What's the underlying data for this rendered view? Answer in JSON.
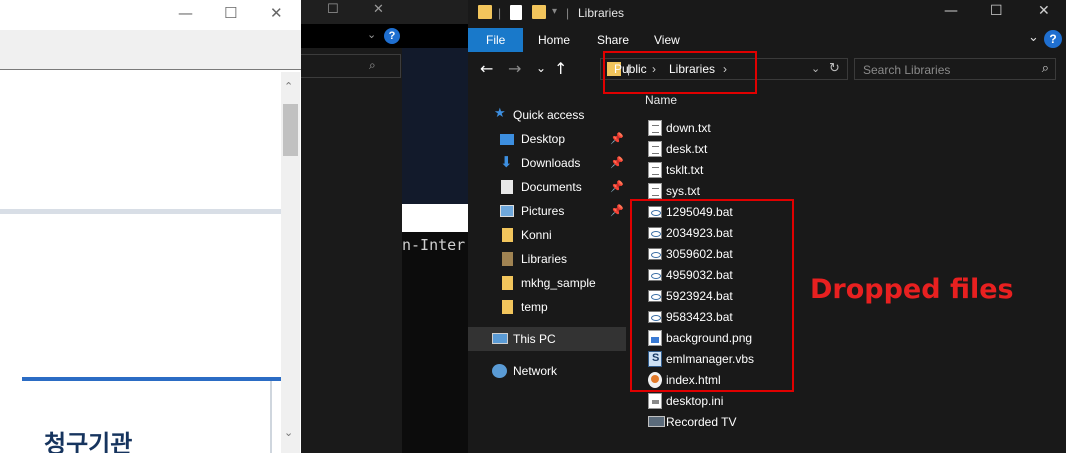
{
  "left_window": {
    "title_controls": [
      "—",
      "☐",
      "✕"
    ],
    "scroll_up": "⌃",
    "scroll_down": "⌄",
    "heading": "청구기관"
  },
  "middle_window": {
    "title_controls": [
      "☐",
      "✕"
    ],
    "help_label": "?",
    "terminal_text": "n-Inter"
  },
  "explorer": {
    "title": "Libraries",
    "title_controls": [
      "—",
      "☐",
      "✕"
    ],
    "ribbon": {
      "tabs": [
        "File",
        "Home",
        "Share",
        "View"
      ],
      "collapse_icon": "chevron-down-icon",
      "help_label": "?"
    },
    "nav_buttons": {
      "back": "←",
      "forward": "→",
      "recent": "⌄",
      "up": "↑"
    },
    "address": {
      "crumbs": [
        "Public",
        "Libraries"
      ],
      "separator": "›",
      "dropdown": "⌄",
      "refresh": "↻"
    },
    "search": {
      "placeholder": "Search Libraries",
      "icon": "search-icon"
    },
    "nav_pane": [
      {
        "label": "Quick access",
        "icon": "star-icon",
        "pinned": false
      },
      {
        "label": "Desktop",
        "icon": "desktop-icon",
        "pinned": true
      },
      {
        "label": "Downloads",
        "icon": "download-icon",
        "pinned": true
      },
      {
        "label": "Documents",
        "icon": "documents-icon",
        "pinned": true
      },
      {
        "label": "Pictures",
        "icon": "pictures-icon",
        "pinned": true
      },
      {
        "label": "Konni",
        "icon": "folder-icon",
        "pinned": false
      },
      {
        "label": "Libraries",
        "icon": "folder-icon",
        "pinned": false
      },
      {
        "label": "mkhg_sample",
        "icon": "folder-icon",
        "pinned": false
      },
      {
        "label": "temp",
        "icon": "folder-icon",
        "pinned": false
      },
      {
        "label": "This PC",
        "icon": "pc-icon",
        "pinned": false,
        "selected": true
      },
      {
        "label": "Network",
        "icon": "network-icon",
        "pinned": false
      }
    ],
    "column_header": "Name",
    "files": [
      {
        "name": "down.txt",
        "type": "txt"
      },
      {
        "name": "desk.txt",
        "type": "txt"
      },
      {
        "name": "tsklt.txt",
        "type": "txt"
      },
      {
        "name": "sys.txt",
        "type": "txt"
      },
      {
        "name": "1295049.bat",
        "type": "bat"
      },
      {
        "name": "2034923.bat",
        "type": "bat"
      },
      {
        "name": "3059602.bat",
        "type": "bat"
      },
      {
        "name": "4959032.bat",
        "type": "bat"
      },
      {
        "name": "5923924.bat",
        "type": "bat"
      },
      {
        "name": "9583423.bat",
        "type": "bat"
      },
      {
        "name": "background.png",
        "type": "png"
      },
      {
        "name": "emlmanager.vbs",
        "type": "vbs"
      },
      {
        "name": "index.html",
        "type": "html"
      },
      {
        "name": "desktop.ini",
        "type": "ini"
      },
      {
        "name": "Recorded TV",
        "type": "tv"
      }
    ]
  },
  "annotation": {
    "label": "Dropped files",
    "color": "#e82020"
  },
  "colors": {
    "ribbon_file_tab": "#1979ca",
    "highlight_border": "#e00000",
    "folder": "#f2c55c"
  }
}
